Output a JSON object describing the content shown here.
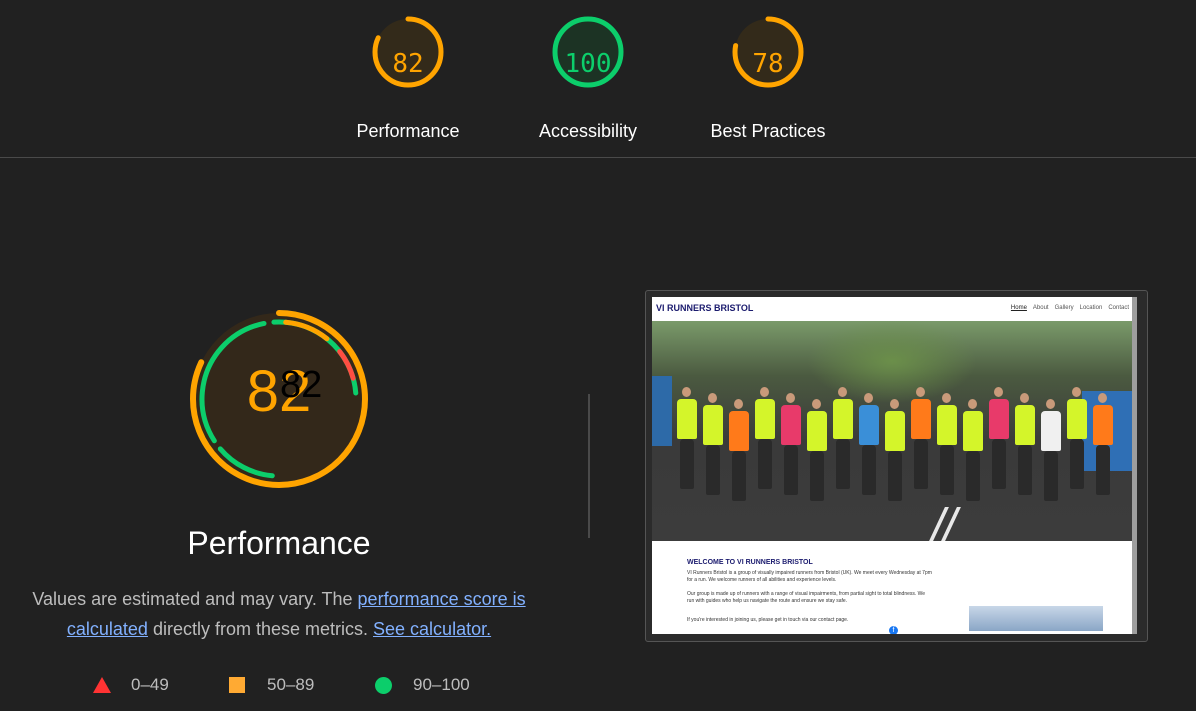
{
  "top_scores": [
    {
      "score": "82",
      "label": "Performance",
      "value": 82,
      "color": "#ffa400"
    },
    {
      "score": "100",
      "label": "Accessibility",
      "value": 100,
      "color": "#0cce6b"
    },
    {
      "score": "78",
      "label": "Best Practices",
      "value": 78,
      "color": "#ffa400"
    }
  ],
  "performance": {
    "score": "82",
    "score_overlay": "82",
    "value": 82,
    "title": "Performance",
    "desc_prefix": "Values are estimated and may vary. The ",
    "link_score": "performance score is calculated",
    "desc_middle": " directly from these metrics. ",
    "link_calculator": "See calculator."
  },
  "legend": [
    {
      "range": "0–49",
      "shape": "triangle",
      "color": "#ff3333"
    },
    {
      "range": "50–89",
      "shape": "square",
      "color": "#ffa400"
    },
    {
      "range": "90–100",
      "shape": "circle",
      "color": "#0cce6b"
    }
  ],
  "screenshot": {
    "brand": "VI RUNNERS BRISTOL",
    "nav": [
      "Home",
      "About",
      "Gallery",
      "Location",
      "Contact"
    ],
    "heading": "WELCOME TO VI RUNNERS BRISTOL",
    "para1": "VI Runners Bristol is a group of visually impaired runners from Bristol (UK). We meet every Wednesday at 7pm for a run. We welcome runners of all abilities and experience levels.",
    "para2": "Our group is made up of runners with a range of visual impairments, from partial sight to total blindness. We run with guides who help us navigate the route and ensure we stay safe.",
    "para3": "If you're interested in joining us, please get in touch via our contact page.",
    "fb": "f"
  }
}
